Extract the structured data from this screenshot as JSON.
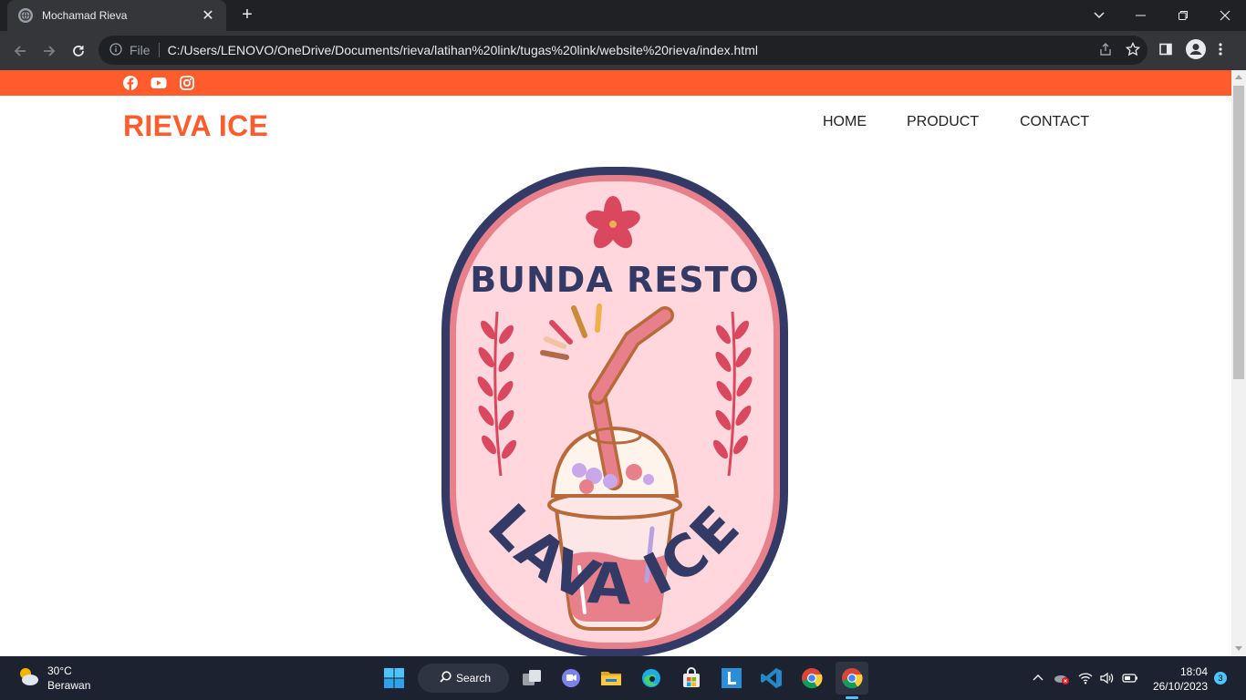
{
  "browser": {
    "tab_title": "Mochamad Rieva",
    "url_scheme": "File",
    "url": "C:/Users/LENOVO/OneDrive/Documents/rieva/latihan%20link/tugas%20link/website%20rieva/index.html"
  },
  "site": {
    "brand": "RIEVA ICE",
    "nav": [
      "HOME",
      "PRODUCT",
      "CONTACT"
    ],
    "social_icons": [
      "facebook-icon",
      "youtube-icon",
      "instagram-icon"
    ],
    "logo": {
      "top_text": "BUNDA RESTO",
      "bottom_text": "LAVA ICE"
    },
    "colors": {
      "accent": "#ff5c2e",
      "logo_navy": "#343a66",
      "logo_pink": "#ffd7dc",
      "logo_rose": "#e8808c"
    }
  },
  "taskbar": {
    "weather_temp": "30°C",
    "weather_desc": "Berawan",
    "search_label": "Search",
    "time": "18:04",
    "date": "26/10/2023",
    "notification_count": "3"
  }
}
